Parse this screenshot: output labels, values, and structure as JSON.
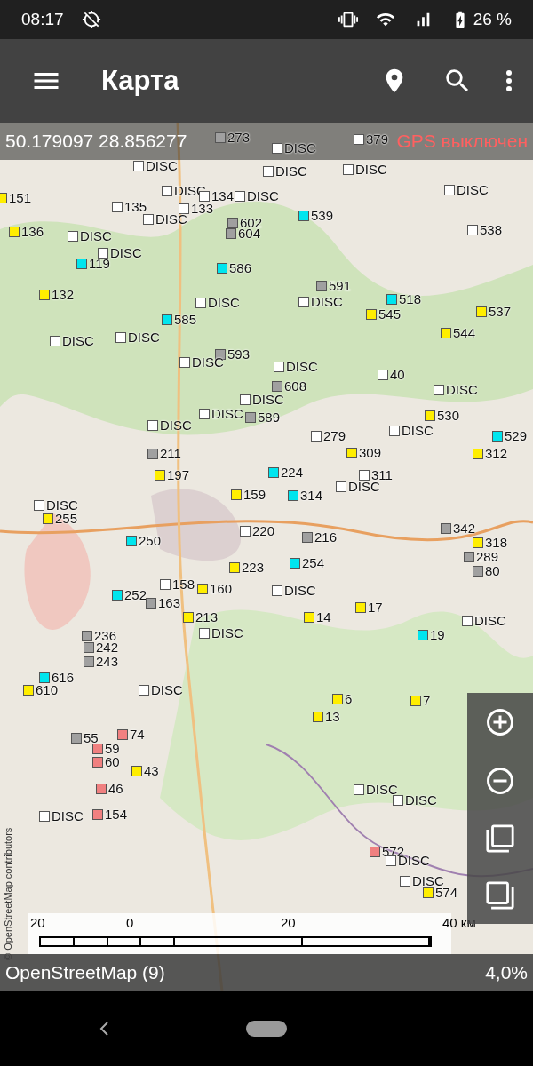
{
  "status_bar": {
    "time": "08:17",
    "battery": "26 %"
  },
  "toolbar": {
    "title": "Карта"
  },
  "coordinates": "50.179097 28.856277",
  "gps_status": "GPS выключен",
  "markers": [
    {
      "label": "273",
      "color": "#a0a0a0"
    },
    {
      "label": "DISC",
      "color": "#ffffff"
    },
    {
      "label": "379",
      "color": "#ffffff"
    },
    {
      "label": "DISC",
      "color": "#ffffff"
    },
    {
      "label": "DISC",
      "color": "#ffffff"
    },
    {
      "label": "DISC",
      "color": "#ffffff"
    },
    {
      "label": "151",
      "color": "#ffee00"
    },
    {
      "label": "DISC",
      "color": "#ffffff"
    },
    {
      "label": "134",
      "color": "#ffffff"
    },
    {
      "label": "DISC",
      "color": "#ffffff"
    },
    {
      "label": "DISC",
      "color": "#ffffff"
    },
    {
      "label": "135",
      "color": "#ffffff"
    },
    {
      "label": "133",
      "color": "#ffffff"
    },
    {
      "label": "DISC",
      "color": "#ffffff"
    },
    {
      "label": "539",
      "color": "#00e5ee"
    },
    {
      "label": "602",
      "color": "#a0a0a0"
    },
    {
      "label": "136",
      "color": "#ffee00"
    },
    {
      "label": "604",
      "color": "#a0a0a0"
    },
    {
      "label": "538",
      "color": "#ffffff"
    },
    {
      "label": "DISC",
      "color": "#ffffff"
    },
    {
      "label": "DISC",
      "color": "#ffffff"
    },
    {
      "label": "119",
      "color": "#00e5ee"
    },
    {
      "label": "586",
      "color": "#00e5ee"
    },
    {
      "label": "591",
      "color": "#a0a0a0"
    },
    {
      "label": "132",
      "color": "#ffee00"
    },
    {
      "label": "518",
      "color": "#00e5ee"
    },
    {
      "label": "DISC",
      "color": "#ffffff"
    },
    {
      "label": "DISC",
      "color": "#ffffff"
    },
    {
      "label": "545",
      "color": "#ffee00"
    },
    {
      "label": "537",
      "color": "#ffee00"
    },
    {
      "label": "585",
      "color": "#00e5ee"
    },
    {
      "label": "DISC",
      "color": "#ffffff"
    },
    {
      "label": "DISC",
      "color": "#ffffff"
    },
    {
      "label": "544",
      "color": "#ffee00"
    },
    {
      "label": "593",
      "color": "#a0a0a0"
    },
    {
      "label": "DISC",
      "color": "#ffffff"
    },
    {
      "label": "DISC",
      "color": "#ffffff"
    },
    {
      "label": "40",
      "color": "#ffffff"
    },
    {
      "label": "DISC",
      "color": "#ffffff"
    },
    {
      "label": "608",
      "color": "#a0a0a0"
    },
    {
      "label": "DISC",
      "color": "#ffffff"
    },
    {
      "label": "DISC",
      "color": "#ffffff"
    },
    {
      "label": "589",
      "color": "#a0a0a0"
    },
    {
      "label": "530",
      "color": "#ffee00"
    },
    {
      "label": "DISC",
      "color": "#ffffff"
    },
    {
      "label": "DISC",
      "color": "#ffffff"
    },
    {
      "label": "279",
      "color": "#ffffff"
    },
    {
      "label": "529",
      "color": "#00e5ee"
    },
    {
      "label": "211",
      "color": "#a0a0a0"
    },
    {
      "label": "309",
      "color": "#ffee00"
    },
    {
      "label": "312",
      "color": "#ffee00"
    },
    {
      "label": "197",
      "color": "#ffee00"
    },
    {
      "label": "224",
      "color": "#00e5ee"
    },
    {
      "label": "311",
      "color": "#ffffff"
    },
    {
      "label": "DISC",
      "color": "#ffffff"
    },
    {
      "label": "159",
      "color": "#ffee00"
    },
    {
      "label": "314",
      "color": "#00e5ee"
    },
    {
      "label": "DISC",
      "color": "#ffffff"
    },
    {
      "label": "255",
      "color": "#ffee00"
    },
    {
      "label": "220",
      "color": "#ffffff"
    },
    {
      "label": "250",
      "color": "#00e5ee"
    },
    {
      "label": "216",
      "color": "#a0a0a0"
    },
    {
      "label": "342",
      "color": "#a0a0a0"
    },
    {
      "label": "318",
      "color": "#ffee00"
    },
    {
      "label": "289",
      "color": "#a0a0a0"
    },
    {
      "label": "254",
      "color": "#00e5ee"
    },
    {
      "label": "223",
      "color": "#ffee00"
    },
    {
      "label": "80",
      "color": "#a0a0a0"
    },
    {
      "label": "158",
      "color": "#ffffff"
    },
    {
      "label": "160",
      "color": "#ffee00"
    },
    {
      "label": "DISC",
      "color": "#ffffff"
    },
    {
      "label": "252",
      "color": "#00e5ee"
    },
    {
      "label": "163",
      "color": "#a0a0a0"
    },
    {
      "label": "213",
      "color": "#ffee00"
    },
    {
      "label": "14",
      "color": "#ffee00"
    },
    {
      "label": "17",
      "color": "#ffee00"
    },
    {
      "label": "DISC",
      "color": "#ffffff"
    },
    {
      "label": "236",
      "color": "#a0a0a0"
    },
    {
      "label": "DISC",
      "color": "#ffffff"
    },
    {
      "label": "19",
      "color": "#00e5ee"
    },
    {
      "label": "242",
      "color": "#a0a0a0"
    },
    {
      "label": "243",
      "color": "#a0a0a0"
    },
    {
      "label": "616",
      "color": "#00e5ee"
    },
    {
      "label": "610",
      "color": "#ffee00"
    },
    {
      "label": "DISC",
      "color": "#ffffff"
    },
    {
      "label": "6",
      "color": "#ffee00"
    },
    {
      "label": "7",
      "color": "#ffee00"
    },
    {
      "label": "13",
      "color": "#ffee00"
    },
    {
      "label": "55",
      "color": "#a0a0a0"
    },
    {
      "label": "74",
      "color": "#f08080"
    },
    {
      "label": "59",
      "color": "#f08080"
    },
    {
      "label": "60",
      "color": "#f08080"
    },
    {
      "label": "43",
      "color": "#ffee00"
    },
    {
      "label": "46",
      "color": "#f08080"
    },
    {
      "label": "DISC",
      "color": "#ffffff"
    },
    {
      "label": "DISC",
      "color": "#ffffff"
    },
    {
      "label": "DISC",
      "color": "#ffffff"
    },
    {
      "label": "154",
      "color": "#f08080"
    },
    {
      "label": "572",
      "color": "#f08080"
    },
    {
      "label": "DISC",
      "color": "#ffffff"
    },
    {
      "label": "DISC",
      "color": "#ffffff"
    },
    {
      "label": "574",
      "color": "#ffee00"
    }
  ],
  "attribution": "© OpenStreetMap contributors",
  "scale": [
    "20",
    "0",
    "20",
    "40 км"
  ],
  "bottom_bar": {
    "layer": "OpenStreetMap (9)",
    "progress": "4,0%"
  }
}
